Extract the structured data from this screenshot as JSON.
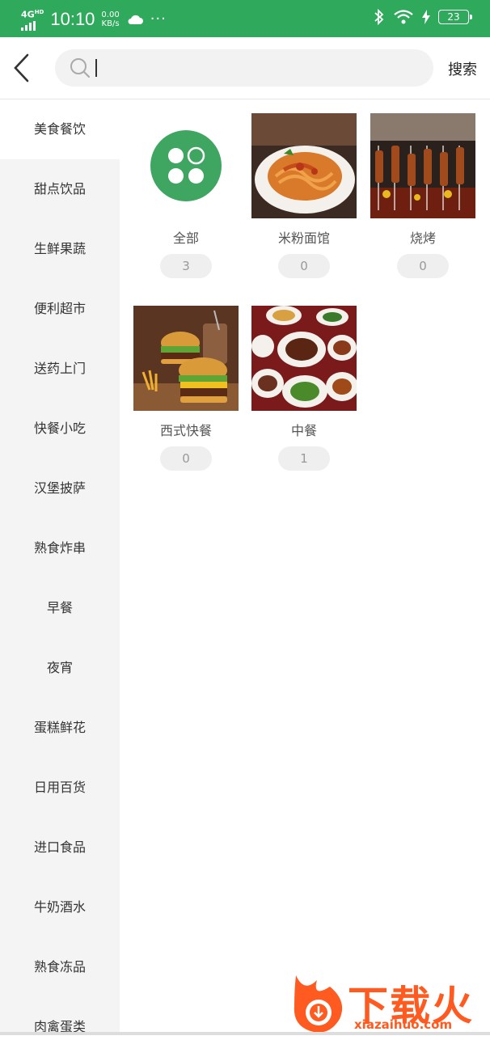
{
  "status": {
    "network": "4G",
    "network_sup": "HD",
    "time": "10:10",
    "speed_value": "0.00",
    "speed_unit": "KB/s",
    "more": "···",
    "battery": "23"
  },
  "header": {
    "search_placeholder": "",
    "search_label": "搜索"
  },
  "sidebar": {
    "items": [
      {
        "label": "美食餐饮",
        "active": true
      },
      {
        "label": "甜点饮品"
      },
      {
        "label": "生鲜果蔬"
      },
      {
        "label": "便利超市"
      },
      {
        "label": "送药上门"
      },
      {
        "label": "快餐小吃"
      },
      {
        "label": "汉堡披萨"
      },
      {
        "label": "熟食炸串"
      },
      {
        "label": "早餐"
      },
      {
        "label": "夜宵"
      },
      {
        "label": "蛋糕鲜花"
      },
      {
        "label": "日用百货"
      },
      {
        "label": "进口食品"
      },
      {
        "label": "牛奶酒水"
      },
      {
        "label": "熟食冻品"
      },
      {
        "label": "肉禽蛋类"
      }
    ]
  },
  "categories": [
    {
      "label": "全部",
      "count": "3",
      "icon": "clover-icon"
    },
    {
      "label": "米粉面馆",
      "count": "0",
      "icon": "noodle-photo"
    },
    {
      "label": "烧烤",
      "count": "0",
      "icon": "bbq-photo"
    },
    {
      "label": "西式快餐",
      "count": "0",
      "icon": "burger-photo"
    },
    {
      "label": "中餐",
      "count": "1",
      "icon": "chinese-dishes-photo"
    }
  ],
  "watermark": {
    "title": "下载火",
    "url": "xiazaihuo.com"
  },
  "colors": {
    "brand": "#2faa5c",
    "watermark": "#ff5a1f"
  }
}
